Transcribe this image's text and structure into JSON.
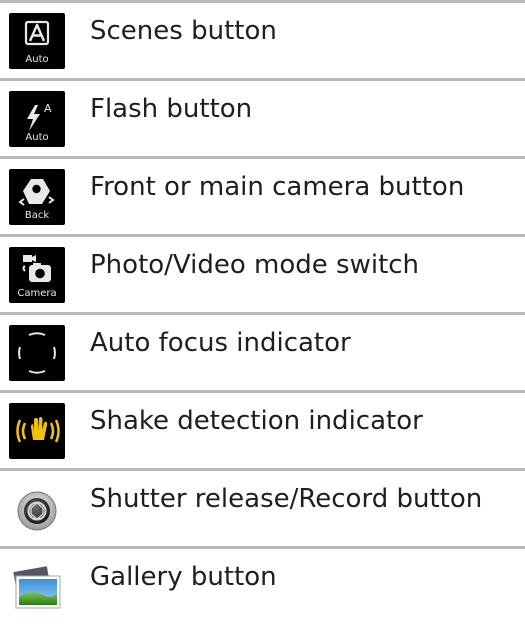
{
  "items": [
    {
      "label": "Scenes button",
      "icon": "scenes-icon",
      "caption": "Auto"
    },
    {
      "label": "Flash button",
      "icon": "flash-icon",
      "caption": "Auto",
      "badge": "A"
    },
    {
      "label": "Front or main camera button",
      "icon": "camera-switch-icon",
      "caption": "Back"
    },
    {
      "label": "Photo/Video mode switch",
      "icon": "photo-video-switch-icon",
      "caption": "Camera"
    },
    {
      "label": "Auto focus indicator",
      "icon": "focus-bracket-icon"
    },
    {
      "label": "Shake detection indicator",
      "icon": "shake-hand-icon"
    },
    {
      "label": "Shutter release/Record button",
      "icon": "shutter-icon"
    },
    {
      "label": "Gallery button",
      "icon": "gallery-icon"
    }
  ],
  "colors": {
    "divider": "#b9b9b9",
    "text": "#1e1e1e",
    "icon_bg": "#000000",
    "shake_yellow": "#f5c400"
  }
}
